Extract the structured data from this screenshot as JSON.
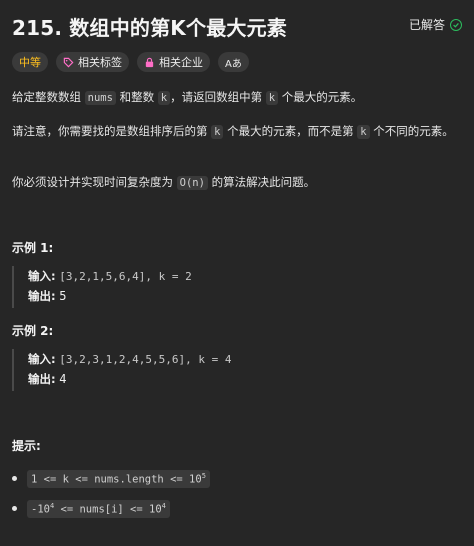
{
  "header": {
    "title": "215. 数组中的第K个最大元素",
    "solved_label": "已解答",
    "solved_icon": "check-circle-icon"
  },
  "tags": {
    "difficulty": "中等",
    "related_tags": "相关标签",
    "related_companies": "相关企业",
    "font_icon": "Aあ"
  },
  "description": {
    "p1_a": "给定整数数组 ",
    "p1_nums": "nums",
    "p1_b": " 和整数 ",
    "p1_k": "k",
    "p1_c": "，请返回数组中第 ",
    "p1_k2": "k",
    "p1_d": " 个最大的元素。",
    "p2_a": "请注意，你需要找的是数组排序后的第 ",
    "p2_k": "k",
    "p2_b": " 个最大的元素，而不是第 ",
    "p2_k2": "k",
    "p2_c": " 个不同的元素。",
    "p3_a": "你必须设计并实现时间复杂度为 ",
    "p3_on": "O(n)",
    "p3_b": " 的算法解决此问题。"
  },
  "examples": [
    {
      "title": "示例 1:",
      "input_label": "输入:",
      "input_value": "[3,2,1,5,6,4], k = 2",
      "output_label": "输出:",
      "output_value": "5"
    },
    {
      "title": "示例 2:",
      "input_label": "输入:",
      "input_value": "[3,2,3,1,2,4,5,5,6], k = 4",
      "output_label": "输出:",
      "output_value": "4"
    }
  ],
  "hints": {
    "title": "提示:",
    "c1_a": "1 <= k <= nums.length <= 10",
    "c1_exp": "5",
    "c2_a": "-10",
    "c2_exp1": "4",
    "c2_b": " <= nums[i] <= 10",
    "c2_exp2": "4"
  },
  "colors": {
    "background": "#262626",
    "difficulty": "#ffc01e",
    "accent_pink": "#ff6ec7",
    "solved": "#2cbb5d"
  }
}
